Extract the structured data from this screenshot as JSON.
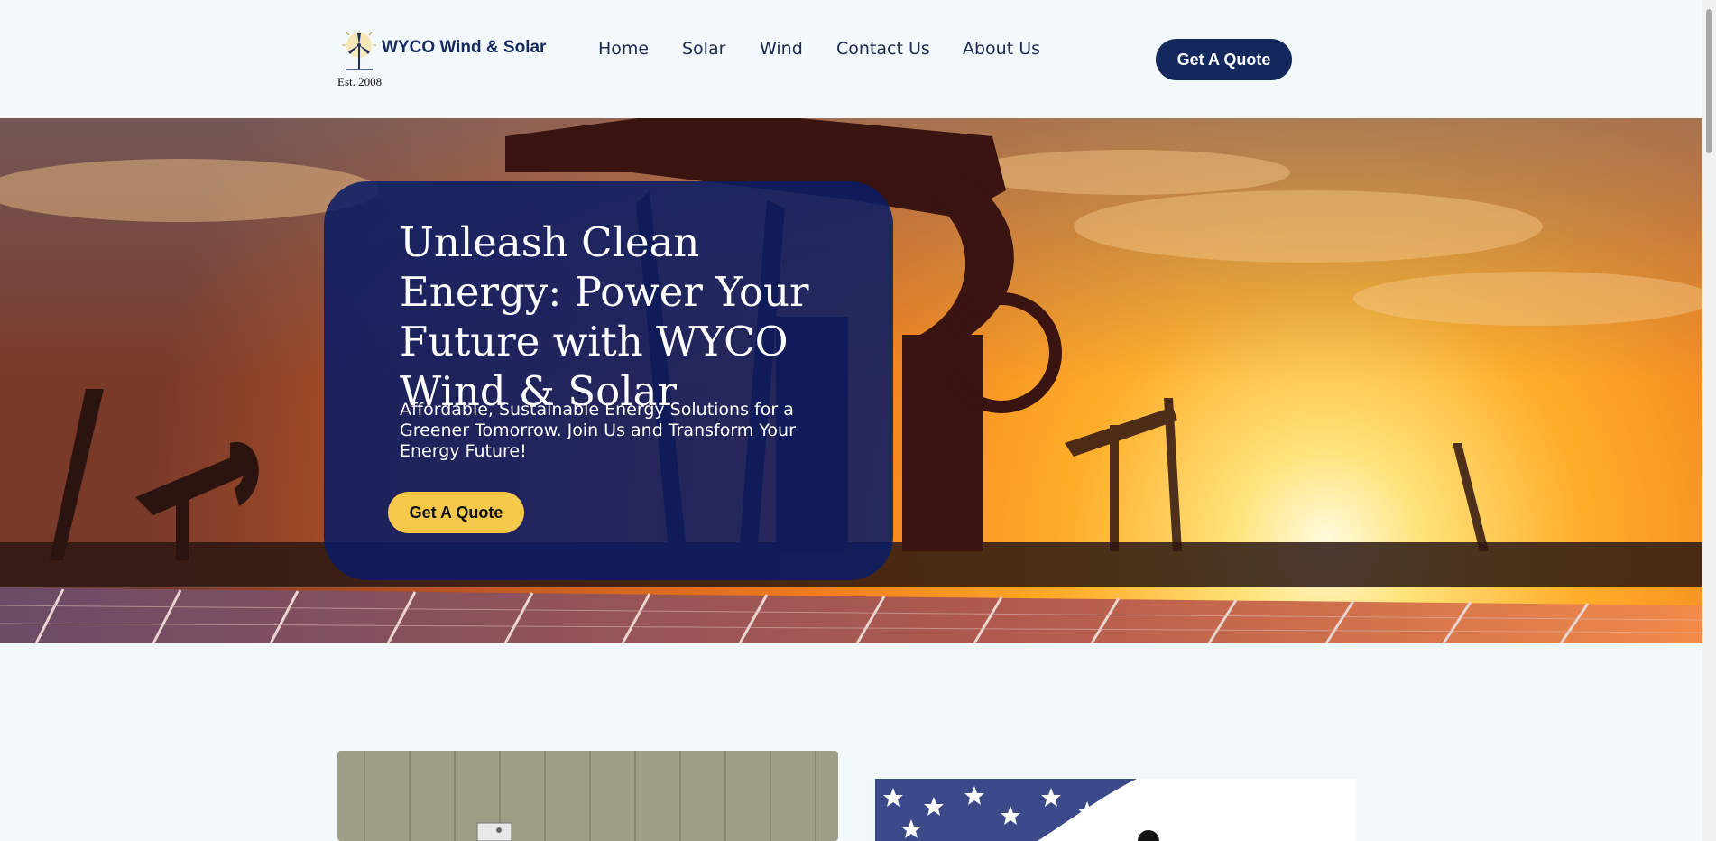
{
  "header": {
    "brand_name": "WYCO Wind  & Solar",
    "tagline": "Est. 2008",
    "logo_icon": "wind-turbine-sun-icon",
    "nav": [
      "Home",
      "Solar",
      "Wind",
      "Contact Us",
      "About Us"
    ],
    "cta_label": "Get A Quote"
  },
  "hero": {
    "title": "Unleash Clean Energy: Power Your Future with WYCO Wind & Solar",
    "subtitle": "Affordable, Sustainable Energy Solutions for a Greener Tomorrow. Join Us and Transform Your Energy Future!",
    "cta_label": "Get A Quote",
    "image_description": "sunset-oil-pumpjacks-solar-panels"
  },
  "colors": {
    "navy": "#13285c",
    "card_blue": "#0a1c64",
    "yellow": "#f7c94a",
    "page_bg": "#f3f8fc"
  }
}
